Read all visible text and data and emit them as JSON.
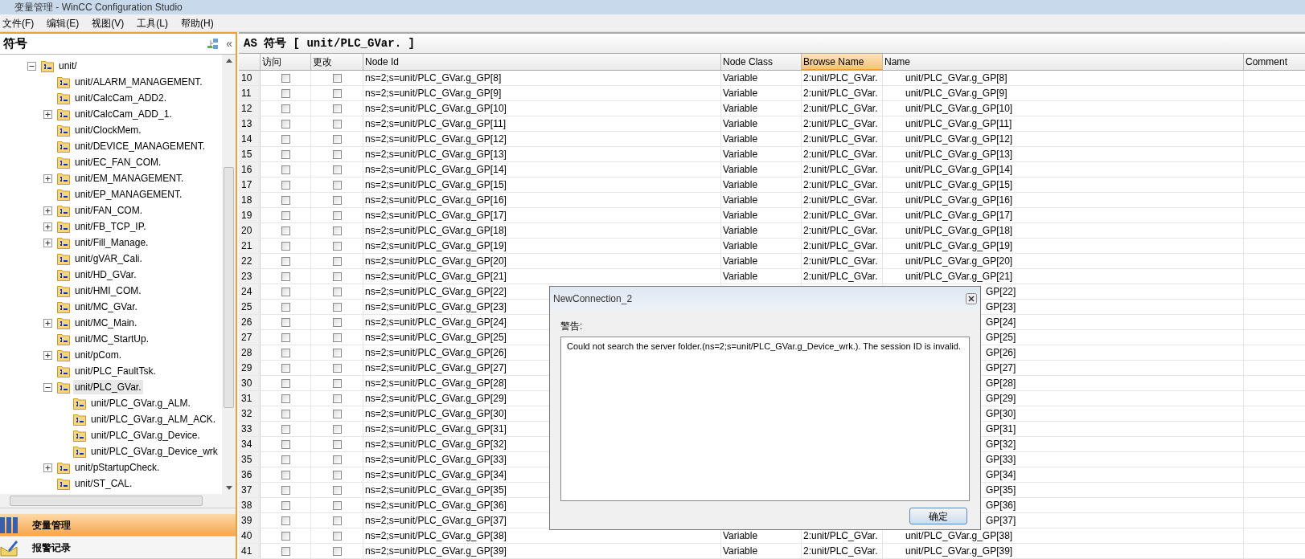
{
  "window": {
    "title": "变量管理 - WinCC Configuration Studio"
  },
  "menu": [
    "文件(F)",
    "编辑(E)",
    "视图(V)",
    "工具(L)",
    "帮助(H)"
  ],
  "sidebar": {
    "title": "符号",
    "collapse_glyph": "«",
    "tree": [
      {
        "label": "unit/",
        "expanded": true,
        "selected": false,
        "children": [
          {
            "label": "unit/ALARM_MANAGEMENT.",
            "selected": false
          },
          {
            "label": "unit/CalcCam_ADD2.",
            "selected": false
          },
          {
            "label": "unit/CalcCam_ADD_1.",
            "expanded": false,
            "selected": false
          },
          {
            "label": "unit/ClockMem.",
            "selected": false
          },
          {
            "label": "unit/DEVICE_MANAGEMENT.",
            "selected": false
          },
          {
            "label": "unit/EC_FAN_COM.",
            "selected": false
          },
          {
            "label": "unit/EM_MANAGEMENT.",
            "expanded": false,
            "selected": false
          },
          {
            "label": "unit/EP_MANAGEMENT.",
            "selected": false
          },
          {
            "label": "unit/FAN_COM.",
            "expanded": false,
            "selected": false
          },
          {
            "label": "unit/FB_TCP_IP.",
            "expanded": false,
            "selected": false
          },
          {
            "label": "unit/Fill_Manage.",
            "expanded": false,
            "selected": false
          },
          {
            "label": "unit/gVAR_Cali.",
            "selected": false
          },
          {
            "label": "unit/HD_GVar.",
            "selected": false
          },
          {
            "label": "unit/HMI_COM.",
            "selected": false
          },
          {
            "label": "unit/MC_GVar.",
            "selected": false
          },
          {
            "label": "unit/MC_Main.",
            "expanded": false,
            "selected": false
          },
          {
            "label": "unit/MC_StartUp.",
            "selected": false
          },
          {
            "label": "unit/pCom.",
            "expanded": false,
            "selected": false
          },
          {
            "label": "unit/PLC_FaultTsk.",
            "selected": false
          },
          {
            "label": "unit/PLC_GVar.",
            "expanded": true,
            "selected": true,
            "children": [
              {
                "label": "unit/PLC_GVar.g_ALM.",
                "selected": false
              },
              {
                "label": "unit/PLC_GVar.g_ALM_ACK.",
                "selected": false
              },
              {
                "label": "unit/PLC_GVar.g_Device.",
                "selected": false
              },
              {
                "label": "unit/PLC_GVar.g_Device_wrk",
                "selected": false
              }
            ]
          },
          {
            "label": "unit/pStartupCheck.",
            "expanded": false,
            "selected": false
          },
          {
            "label": "unit/ST_CAL.",
            "selected": false
          }
        ]
      }
    ],
    "nav": [
      {
        "label": "变量管理",
        "kind": "tags",
        "selected": true
      },
      {
        "label": "报警记录",
        "kind": "alarms",
        "selected": false
      }
    ]
  },
  "table": {
    "title": "AS 符号 [ unit/PLC_GVar. ]",
    "columns": [
      {
        "label": "访问",
        "selected": false
      },
      {
        "label": "更改",
        "selected": false
      },
      {
        "label": "Node Id",
        "selected": false
      },
      {
        "label": "Node Class",
        "selected": false
      },
      {
        "label": "Browse Name",
        "selected": true
      },
      {
        "label": "Name",
        "selected": false
      },
      {
        "label": "Comment",
        "selected": false
      }
    ],
    "rows": [
      {
        "num": "10",
        "access": false,
        "change": false,
        "node_id": "ns=2;s=unit/PLC_GVar.g_GP[8]",
        "node_class": "Variable",
        "browse_name": "2:unit/PLC_GVar.",
        "name": "unit/PLC_GVar.g_GP[8]"
      },
      {
        "num": "11",
        "access": false,
        "change": false,
        "node_id": "ns=2;s=unit/PLC_GVar.g_GP[9]",
        "node_class": "Variable",
        "browse_name": "2:unit/PLC_GVar.",
        "name": "unit/PLC_GVar.g_GP[9]"
      },
      {
        "num": "12",
        "access": false,
        "change": false,
        "node_id": "ns=2;s=unit/PLC_GVar.g_GP[10]",
        "node_class": "Variable",
        "browse_name": "2:unit/PLC_GVar.",
        "name": "unit/PLC_GVar.g_GP[10]"
      },
      {
        "num": "13",
        "access": false,
        "change": false,
        "node_id": "ns=2;s=unit/PLC_GVar.g_GP[11]",
        "node_class": "Variable",
        "browse_name": "2:unit/PLC_GVar.",
        "name": "unit/PLC_GVar.g_GP[11]"
      },
      {
        "num": "14",
        "access": false,
        "change": false,
        "node_id": "ns=2;s=unit/PLC_GVar.g_GP[12]",
        "node_class": "Variable",
        "browse_name": "2:unit/PLC_GVar.",
        "name": "unit/PLC_GVar.g_GP[12]"
      },
      {
        "num": "15",
        "access": false,
        "change": false,
        "node_id": "ns=2;s=unit/PLC_GVar.g_GP[13]",
        "node_class": "Variable",
        "browse_name": "2:unit/PLC_GVar.",
        "name": "unit/PLC_GVar.g_GP[13]"
      },
      {
        "num": "16",
        "access": false,
        "change": false,
        "node_id": "ns=2;s=unit/PLC_GVar.g_GP[14]",
        "node_class": "Variable",
        "browse_name": "2:unit/PLC_GVar.",
        "name": "unit/PLC_GVar.g_GP[14]"
      },
      {
        "num": "17",
        "access": false,
        "change": false,
        "node_id": "ns=2;s=unit/PLC_GVar.g_GP[15]",
        "node_class": "Variable",
        "browse_name": "2:unit/PLC_GVar.",
        "name": "unit/PLC_GVar.g_GP[15]"
      },
      {
        "num": "18",
        "access": false,
        "change": false,
        "node_id": "ns=2;s=unit/PLC_GVar.g_GP[16]",
        "node_class": "Variable",
        "browse_name": "2:unit/PLC_GVar.",
        "name": "unit/PLC_GVar.g_GP[16]"
      },
      {
        "num": "19",
        "access": false,
        "change": false,
        "node_id": "ns=2;s=unit/PLC_GVar.g_GP[17]",
        "node_class": "Variable",
        "browse_name": "2:unit/PLC_GVar.",
        "name": "unit/PLC_GVar.g_GP[17]"
      },
      {
        "num": "20",
        "access": false,
        "change": false,
        "node_id": "ns=2;s=unit/PLC_GVar.g_GP[18]",
        "node_class": "Variable",
        "browse_name": "2:unit/PLC_GVar.",
        "name": "unit/PLC_GVar.g_GP[18]"
      },
      {
        "num": "21",
        "access": false,
        "change": false,
        "node_id": "ns=2;s=unit/PLC_GVar.g_GP[19]",
        "node_class": "Variable",
        "browse_name": "2:unit/PLC_GVar.",
        "name": "unit/PLC_GVar.g_GP[19]"
      },
      {
        "num": "22",
        "access": false,
        "change": false,
        "node_id": "ns=2;s=unit/PLC_GVar.g_GP[20]",
        "node_class": "Variable",
        "browse_name": "2:unit/PLC_GVar.",
        "name": "unit/PLC_GVar.g_GP[20]"
      },
      {
        "num": "23",
        "access": false,
        "change": false,
        "node_id": "ns=2;s=unit/PLC_GVar.g_GP[21]",
        "node_class": "Variable",
        "browse_name": "2:unit/PLC_GVar.",
        "name": "unit/PLC_GVar.g_GP[21]"
      },
      {
        "num": "24",
        "access": false,
        "change": false,
        "node_id": "ns=2;s=unit/PLC_GVar.g_GP[22]",
        "name": "GP[22]"
      },
      {
        "num": "25",
        "access": false,
        "change": false,
        "node_id": "ns=2;s=unit/PLC_GVar.g_GP[23]",
        "name": "GP[23]"
      },
      {
        "num": "26",
        "access": false,
        "change": false,
        "node_id": "ns=2;s=unit/PLC_GVar.g_GP[24]",
        "name": "GP[24]"
      },
      {
        "num": "27",
        "access": false,
        "change": false,
        "node_id": "ns=2;s=unit/PLC_GVar.g_GP[25]",
        "name": "GP[25]"
      },
      {
        "num": "28",
        "access": false,
        "change": false,
        "node_id": "ns=2;s=unit/PLC_GVar.g_GP[26]",
        "name": "GP[26]"
      },
      {
        "num": "29",
        "access": false,
        "change": false,
        "node_id": "ns=2;s=unit/PLC_GVar.g_GP[27]",
        "name": "GP[27]"
      },
      {
        "num": "30",
        "access": false,
        "change": false,
        "node_id": "ns=2;s=unit/PLC_GVar.g_GP[28]",
        "name": "GP[28]"
      },
      {
        "num": "31",
        "access": false,
        "change": false,
        "node_id": "ns=2;s=unit/PLC_GVar.g_GP[29]",
        "name": "GP[29]"
      },
      {
        "num": "32",
        "access": false,
        "change": false,
        "node_id": "ns=2;s=unit/PLC_GVar.g_GP[30]",
        "name": "GP[30]"
      },
      {
        "num": "33",
        "access": false,
        "change": false,
        "node_id": "ns=2;s=unit/PLC_GVar.g_GP[31]",
        "name": "GP[31]"
      },
      {
        "num": "34",
        "access": false,
        "change": false,
        "node_id": "ns=2;s=unit/PLC_GVar.g_GP[32]",
        "name": "GP[32]"
      },
      {
        "num": "35",
        "access": false,
        "change": false,
        "node_id": "ns=2;s=unit/PLC_GVar.g_GP[33]",
        "name": "GP[33]"
      },
      {
        "num": "36",
        "access": false,
        "change": false,
        "node_id": "ns=2;s=unit/PLC_GVar.g_GP[34]",
        "name": "GP[34]"
      },
      {
        "num": "37",
        "access": false,
        "change": false,
        "node_id": "ns=2;s=unit/PLC_GVar.g_GP[35]",
        "name": "GP[35]"
      },
      {
        "num": "38",
        "access": false,
        "change": false,
        "node_id": "ns=2;s=unit/PLC_GVar.g_GP[36]",
        "name": "GP[36]"
      },
      {
        "num": "39",
        "access": false,
        "change": false,
        "node_id": "ns=2;s=unit/PLC_GVar.g_GP[37]",
        "name": "GP[37]"
      },
      {
        "num": "40",
        "access": false,
        "change": false,
        "node_id": "ns=2;s=unit/PLC_GVar.g_GP[38]",
        "node_class": "Variable",
        "browse_name": "2:unit/PLC_GVar.",
        "name": "unit/PLC_GVar.g_GP[38]"
      },
      {
        "num": "41",
        "access": false,
        "change": false,
        "node_id": "ns=2;s=unit/PLC_GVar.g_GP[39]",
        "node_class": "Variable",
        "browse_name": "2:unit/PLC_GVar.",
        "name": "unit/PLC_GVar.g_GP[39]"
      }
    ]
  },
  "dialog": {
    "title": "NewConnection_2",
    "label": "警告:",
    "message": "Could not search the server folder.(ns=2;s=unit/PLC_GVar.g_Device_wrk.). The session ID is invalid.",
    "ok_button": "确定"
  }
}
